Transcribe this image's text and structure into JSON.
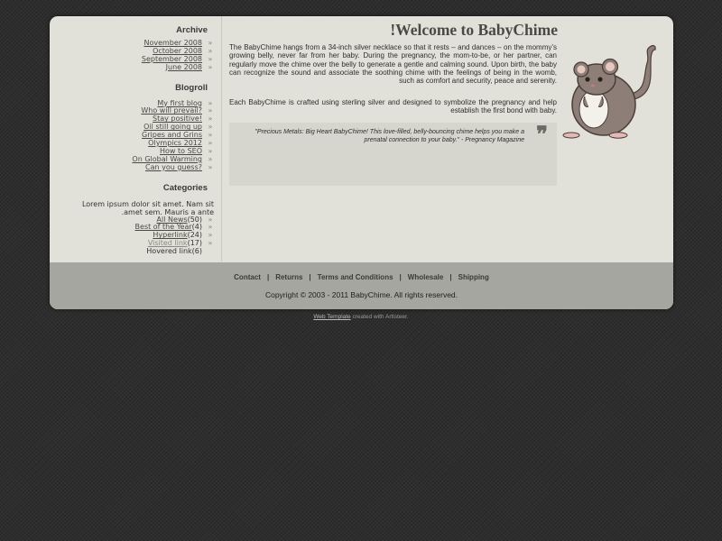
{
  "sidebar": {
    "archive_title": "Archive",
    "archive": [
      "November 2008",
      "October 2008",
      "September 2008",
      "June 2008"
    ],
    "blogroll_title": "Blogroll",
    "blogroll": [
      "My first blog",
      "Who will prevail?",
      "Stay positive!",
      "Oil still going up",
      "Gripes and Grins",
      "Olympics 2012",
      "How to SEO",
      "On Global Warming",
      "Can you guess?"
    ],
    "categories_title": "Categories",
    "categories_text": "Lorem ipsum dolor sit amet. Nam sit amet sem. Mauris a ante.",
    "categories": [
      {
        "label": "All News",
        "count": "(50)"
      },
      {
        "label": "Best of the Year",
        "count": "(4)"
      },
      {
        "label": "Hyperlink",
        "count": "(24)"
      },
      {
        "label": "Visited link",
        "count": "(17)"
      },
      {
        "label": "Hovered link",
        "count": "(6)"
      }
    ]
  },
  "main": {
    "title": "Welcome to BabyChime!",
    "paragraph1": "The BabyChime hangs from a 34-inch silver necklace so that it rests – and dances – on the mommy’s growing belly, never far from her baby. During the pregnancy, the mom-to-be, or her partner, can regularly move the chime over the belly to generate a gentle and calming sound. Upon birth, the baby can recognize the sound and associate the soothing chime with the feelings of being in the womb, such as comfort and security, peace and serenity.",
    "paragraph2": "Each BabyChime is crafted using sterling silver and designed to symbolize the pregnancy and help establish the first bond with baby.",
    "quote": "\"Precious Metals: Big Heart BabyChime! This love-filled, belly-bouncing chime helps you make a prenatal connection to your baby.\" - Pregnancy Magazine",
    "quote_mark": "❞",
    "mascot": "mouse-mascot"
  },
  "footer": {
    "links": [
      "Contact",
      "Returns",
      "Terms and Conditions",
      "Wholesale",
      "Shipping"
    ],
    "separator": "|",
    "copyright": "Copyright © 2003 - 2011 BabyChime. All rights reserved."
  },
  "credit": {
    "link": "Web Template",
    "text": "created with Artisteer."
  },
  "colors": {
    "background": "#2e2e2e",
    "sheet": "#e1e1d9",
    "footer": "#a6a6a0",
    "quote_box": "#d6d6ce",
    "title": "#4a4a44"
  }
}
